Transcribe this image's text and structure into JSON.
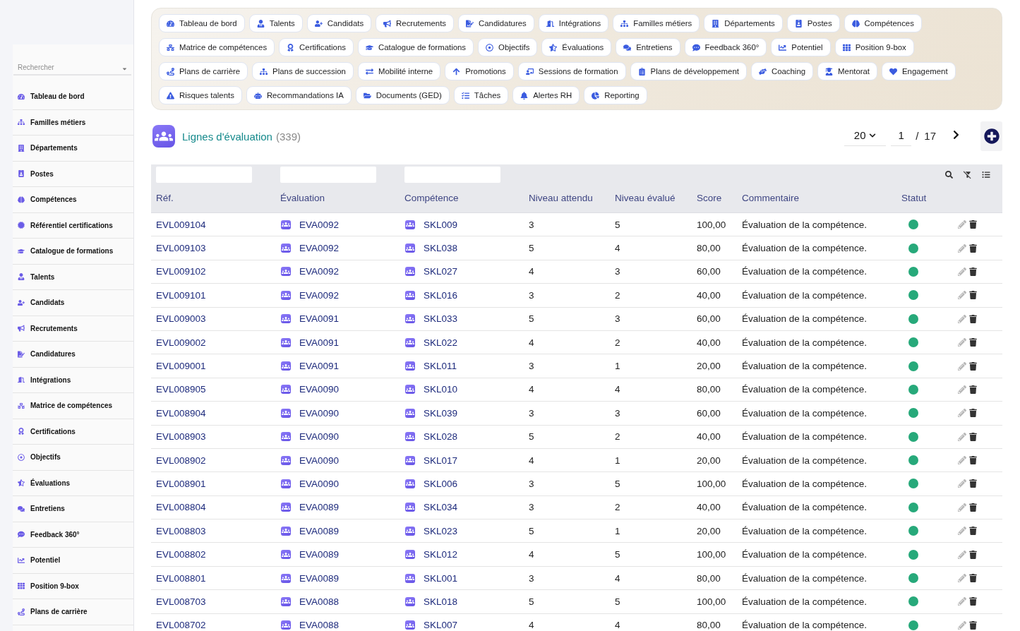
{
  "sidebar": {
    "search": {
      "placeholder": "Rechercher"
    },
    "items": [
      "Tableau de bord",
      "Familles métiers",
      "Départements",
      "Postes",
      "Compétences",
      "Référentiel certifications",
      "Catalogue de formations",
      "Talents",
      "Candidats",
      "Recrutements",
      "Candidatures",
      "Intégrations",
      "Matrice de compétences",
      "Certifications",
      "Objectifs",
      "Évaluations",
      "Entretiens",
      "Feedback 360°",
      "Potentiel",
      "Position 9-box",
      "Plans de carrière"
    ]
  },
  "quick_links": [
    "Tableau de bord",
    "Talents",
    "Candidats",
    "Recrutements",
    "Candidatures",
    "Intégrations",
    "Familles métiers",
    "Départements",
    "Postes",
    "Compétences",
    "Matrice de compétences",
    "Certifications",
    "Catalogue de formations",
    "Objectifs",
    "Évaluations",
    "Entretiens",
    "Feedback 360°",
    "Potentiel",
    "Position 9-box",
    "Plans de carrière",
    "Plans de succession",
    "Mobilité interne",
    "Promotions",
    "Sessions de formation",
    "Plans de développement",
    "Coaching",
    "Mentorat",
    "Engagement",
    "Risques talents",
    "Recommandations IA",
    "Documents (GED)",
    "Tâches",
    "Alertes RH",
    "Reporting"
  ],
  "header": {
    "title": "Lignes d'évaluation",
    "count": "(339)",
    "page_size": "20",
    "page": "1",
    "separator": "/",
    "total_pages": "17"
  },
  "table": {
    "columns": [
      {
        "label": "Réf.",
        "filterable": true
      },
      {
        "label": "Évaluation",
        "filterable": true
      },
      {
        "label": "Compétence",
        "filterable": true
      },
      {
        "label": "Niveau attendu",
        "filterable": false
      },
      {
        "label": "Niveau évalué",
        "filterable": false
      },
      {
        "label": "Score",
        "filterable": false
      },
      {
        "label": "Commentaire",
        "filterable": false
      },
      {
        "label": "Statut",
        "filterable": false
      }
    ],
    "rows": [
      {
        "ref": "EVL009104",
        "evaluation": "EVA0092",
        "competence": "SKL009",
        "expected_level": "3",
        "evaluated_level": "5",
        "score": "100,00",
        "comment": "Évaluation de la compétence.",
        "status": {
          "color": "#27a97a"
        }
      },
      {
        "ref": "EVL009103",
        "evaluation": "EVA0092",
        "competence": "SKL038",
        "expected_level": "5",
        "evaluated_level": "4",
        "score": "80,00",
        "comment": "Évaluation de la compétence.",
        "status": {
          "color": "#27a97a"
        }
      },
      {
        "ref": "EVL009102",
        "evaluation": "EVA0092",
        "competence": "SKL027",
        "expected_level": "4",
        "evaluated_level": "3",
        "score": "60,00",
        "comment": "Évaluation de la compétence.",
        "status": {
          "color": "#27a97a"
        }
      },
      {
        "ref": "EVL009101",
        "evaluation": "EVA0092",
        "competence": "SKL016",
        "expected_level": "3",
        "evaluated_level": "2",
        "score": "40,00",
        "comment": "Évaluation de la compétence.",
        "status": {
          "color": "#27a97a"
        }
      },
      {
        "ref": "EVL009003",
        "evaluation": "EVA0091",
        "competence": "SKL033",
        "expected_level": "5",
        "evaluated_level": "3",
        "score": "60,00",
        "comment": "Évaluation de la compétence.",
        "status": {
          "color": "#27a97a"
        }
      },
      {
        "ref": "EVL009002",
        "evaluation": "EVA0091",
        "competence": "SKL022",
        "expected_level": "4",
        "evaluated_level": "2",
        "score": "40,00",
        "comment": "Évaluation de la compétence.",
        "status": {
          "color": "#27a97a"
        }
      },
      {
        "ref": "EVL009001",
        "evaluation": "EVA0091",
        "competence": "SKL011",
        "expected_level": "3",
        "evaluated_level": "1",
        "score": "20,00",
        "comment": "Évaluation de la compétence.",
        "status": {
          "color": "#27a97a"
        }
      },
      {
        "ref": "EVL008905",
        "evaluation": "EVA0090",
        "competence": "SKL010",
        "expected_level": "4",
        "evaluated_level": "4",
        "score": "80,00",
        "comment": "Évaluation de la compétence.",
        "status": {
          "color": "#27a97a"
        }
      },
      {
        "ref": "EVL008904",
        "evaluation": "EVA0090",
        "competence": "SKL039",
        "expected_level": "3",
        "evaluated_level": "3",
        "score": "60,00",
        "comment": "Évaluation de la compétence.",
        "status": {
          "color": "#27a97a"
        }
      },
      {
        "ref": "EVL008903",
        "evaluation": "EVA0090",
        "competence": "SKL028",
        "expected_level": "5",
        "evaluated_level": "2",
        "score": "40,00",
        "comment": "Évaluation de la compétence.",
        "status": {
          "color": "#27a97a"
        }
      },
      {
        "ref": "EVL008902",
        "evaluation": "EVA0090",
        "competence": "SKL017",
        "expected_level": "4",
        "evaluated_level": "1",
        "score": "20,00",
        "comment": "Évaluation de la compétence.",
        "status": {
          "color": "#27a97a"
        }
      },
      {
        "ref": "EVL008901",
        "evaluation": "EVA0090",
        "competence": "SKL006",
        "expected_level": "3",
        "evaluated_level": "5",
        "score": "100,00",
        "comment": "Évaluation de la compétence.",
        "status": {
          "color": "#27a97a"
        }
      },
      {
        "ref": "EVL008804",
        "evaluation": "EVA0089",
        "competence": "SKL034",
        "expected_level": "3",
        "evaluated_level": "2",
        "score": "40,00",
        "comment": "Évaluation de la compétence.",
        "status": {
          "color": "#27a97a"
        }
      },
      {
        "ref": "EVL008803",
        "evaluation": "EVA0089",
        "competence": "SKL023",
        "expected_level": "5",
        "evaluated_level": "1",
        "score": "20,00",
        "comment": "Évaluation de la compétence.",
        "status": {
          "color": "#27a97a"
        }
      },
      {
        "ref": "EVL008802",
        "evaluation": "EVA0089",
        "competence": "SKL012",
        "expected_level": "4",
        "evaluated_level": "5",
        "score": "100,00",
        "comment": "Évaluation de la compétence.",
        "status": {
          "color": "#27a97a"
        }
      },
      {
        "ref": "EVL008801",
        "evaluation": "EVA0089",
        "competence": "SKL001",
        "expected_level": "3",
        "evaluated_level": "4",
        "score": "80,00",
        "comment": "Évaluation de la compétence.",
        "status": {
          "color": "#27a97a"
        }
      },
      {
        "ref": "EVL008703",
        "evaluation": "EVA0088",
        "competence": "SKL018",
        "expected_level": "5",
        "evaluated_level": "5",
        "score": "100,00",
        "comment": "Évaluation de la compétence.",
        "status": {
          "color": "#27a97a"
        }
      },
      {
        "ref": "EVL008702",
        "evaluation": "EVA0088",
        "competence": "SKL007",
        "expected_level": "4",
        "evaluated_level": "4",
        "score": "80,00",
        "comment": "Évaluation de la compétence.",
        "status": {
          "color": "#27a97a"
        }
      }
    ]
  }
}
